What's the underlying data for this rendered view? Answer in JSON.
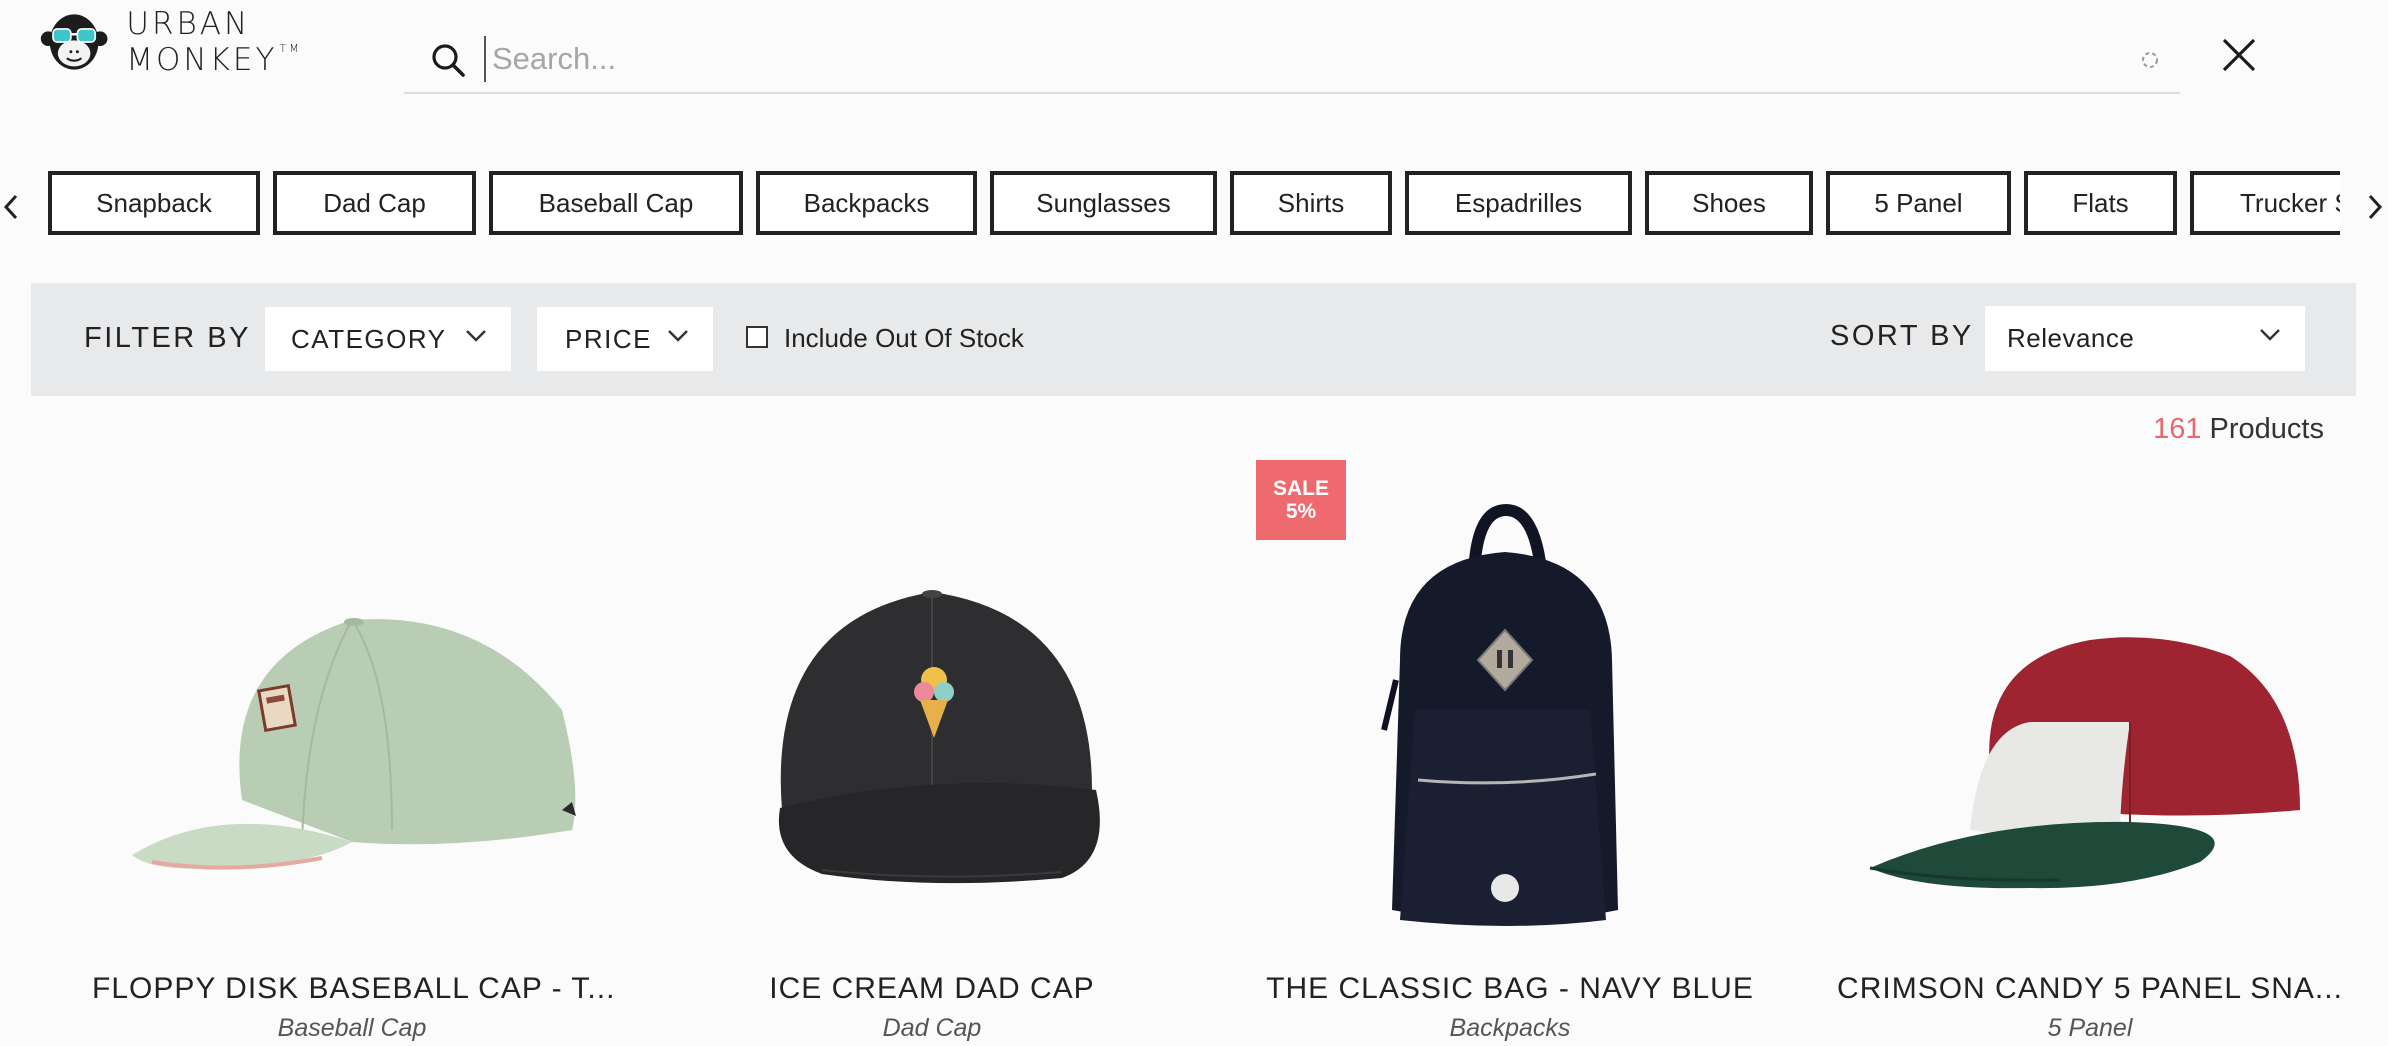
{
  "brand": {
    "name": "URBAN MONKEY",
    "tm": "TM"
  },
  "search": {
    "placeholder": "Search...",
    "value": ""
  },
  "categories": [
    "Snapback",
    "Dad Cap",
    "Baseball Cap",
    "Backpacks",
    "Sunglasses",
    "Shirts",
    "Espadrilles",
    "Shoes",
    "5 Panel",
    "Flats",
    "Trucker S"
  ],
  "filters": {
    "filter_by_label": "FILTER BY",
    "category_label": "CATEGORY",
    "price_label": "PRICE",
    "out_of_stock_label": "Include Out Of Stock",
    "out_of_stock_checked": false,
    "sort_by_label": "SORT BY",
    "sort_value": "Relevance"
  },
  "results": {
    "count": "161",
    "label": "Products"
  },
  "products": [
    {
      "title": "FLOPPY DISK BASEBALL CAP - T...",
      "category": "Baseball Cap"
    },
    {
      "title": "ICE CREAM DAD CAP",
      "category": "Dad Cap"
    },
    {
      "title": "THE CLASSIC BAG - NAVY BLUE",
      "category": "Backpacks",
      "badge_line1": "SALE",
      "badge_line2": "5%"
    },
    {
      "title": "CRIMSON CANDY 5 PANEL SNA...",
      "category": "5 Panel"
    }
  ],
  "colors": {
    "sale_badge": "#ee6a6e",
    "product_count": "#e86a6a",
    "filter_bar": "#e8e9ea"
  },
  "icons": [
    "monkey-logo-icon",
    "search-icon",
    "loading-spinner-icon",
    "close-icon",
    "chevron-left-icon",
    "chevron-right-icon",
    "chevron-down-icon"
  ]
}
